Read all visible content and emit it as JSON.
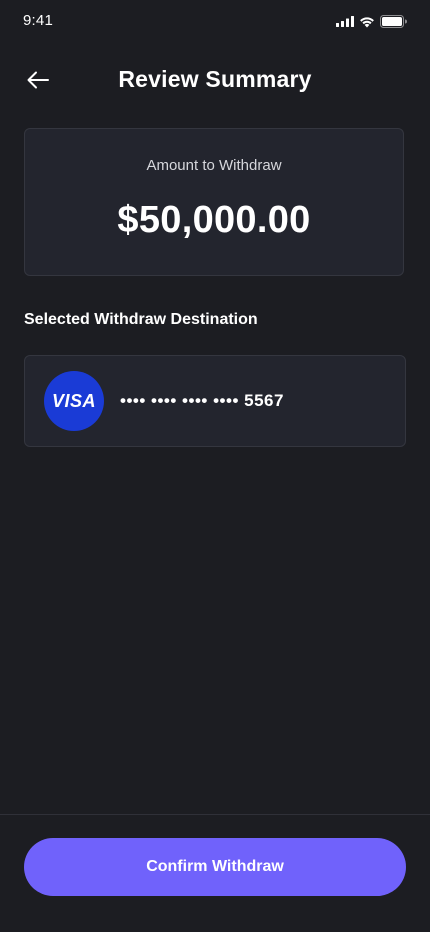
{
  "status_bar": {
    "time": "9:41",
    "icons": [
      "signal-icon",
      "wifi-icon",
      "battery-icon"
    ]
  },
  "header": {
    "title": "Review Summary",
    "back_icon": "arrow-left-icon"
  },
  "amount": {
    "label": "Amount to Withdraw",
    "value": "$50,000.00"
  },
  "destination": {
    "section_title": "Selected Withdraw Destination",
    "brand": "VISA",
    "card_number": "•••• •••• •••• •••• 5567"
  },
  "footer": {
    "confirm_label": "Confirm Withdraw"
  },
  "colors": {
    "background": "#1c1d22",
    "card": "#23252e",
    "accent": "#7062fb",
    "visa_blue": "#1a3bd6"
  }
}
